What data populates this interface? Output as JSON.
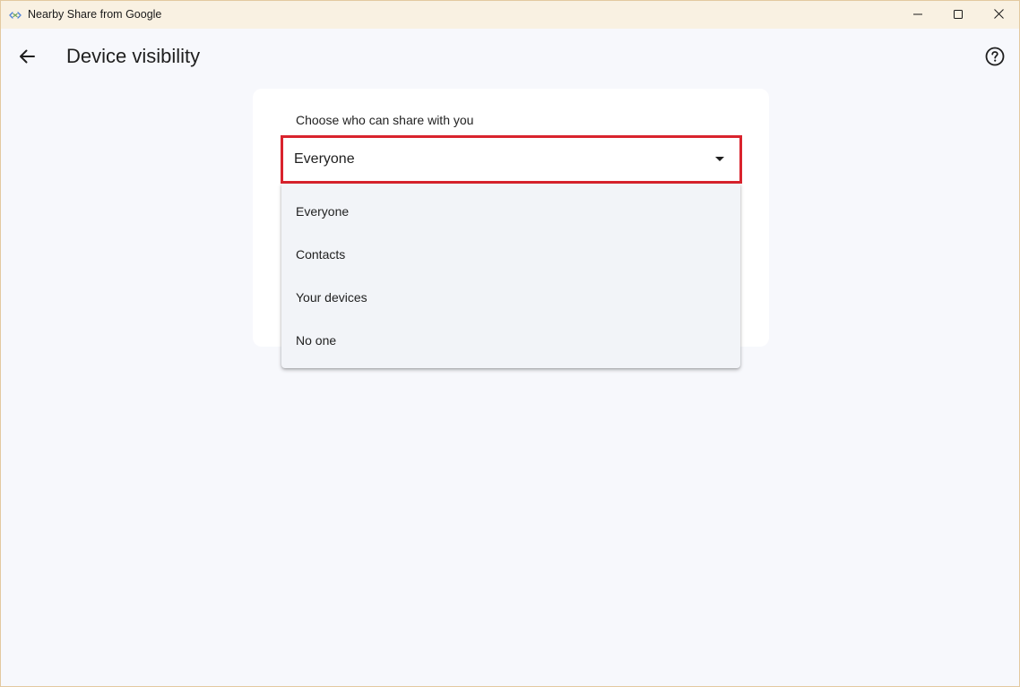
{
  "window": {
    "title": "Nearby Share from Google",
    "app_icon": "nearby-share-icon",
    "controls": {
      "minimize_icon": "minimize-icon",
      "maximize_icon": "maximize-icon",
      "close_icon": "close-icon"
    }
  },
  "header": {
    "back_icon": "arrow-left-icon",
    "title": "Device visibility",
    "help_icon": "help-circle-icon"
  },
  "visibility": {
    "label": "Choose who can share with you",
    "selected": "Everyone",
    "caret_icon": "caret-down-icon",
    "options": [
      {
        "label": "Everyone"
      },
      {
        "label": "Contacts"
      },
      {
        "label": "Your devices"
      },
      {
        "label": "No one"
      }
    ]
  },
  "colors": {
    "highlight_border": "#d9232d",
    "background": "#f7f8fc",
    "titlebar": "#f9f1e2",
    "menu_background": "#f2f4f8"
  }
}
